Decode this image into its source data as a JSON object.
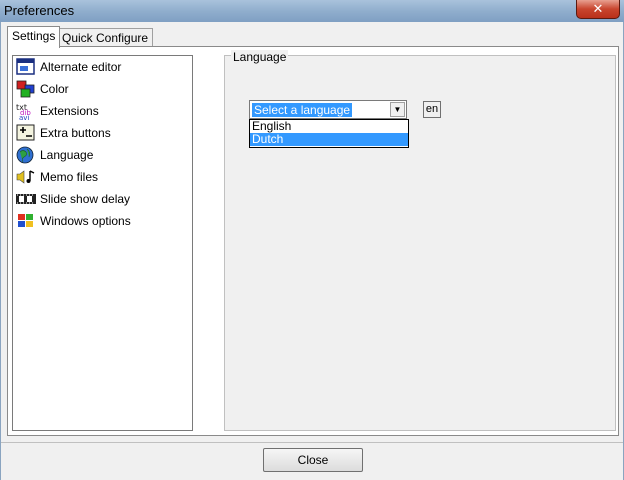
{
  "window": {
    "title": "Preferences",
    "close_glyph": "✕"
  },
  "tabs": [
    {
      "label": "Settings",
      "active": true
    },
    {
      "label": "Quick Configure",
      "active": false
    }
  ],
  "list": {
    "items": [
      {
        "label": "Alternate editor",
        "icon": "editor-window-icon"
      },
      {
        "label": "Color",
        "icon": "color-squares-icon"
      },
      {
        "label": "Extensions",
        "icon": "extensions-icon"
      },
      {
        "label": "Extra buttons",
        "icon": "extra-buttons-icon"
      },
      {
        "label": "Language",
        "icon": "globe-icon"
      },
      {
        "label": "Memo files",
        "icon": "sound-note-icon"
      },
      {
        "label": "Slide show delay",
        "icon": "film-strip-icon"
      },
      {
        "label": "Windows options",
        "icon": "windows-logo-icon"
      }
    ]
  },
  "language_group": {
    "legend": "Language",
    "combo_selected": "Select a language",
    "combo_arrow": "▼",
    "options": [
      "English",
      "Dutch"
    ],
    "highlighted_option": 1,
    "code_button": "en"
  },
  "footer": {
    "close_label": "Close"
  }
}
